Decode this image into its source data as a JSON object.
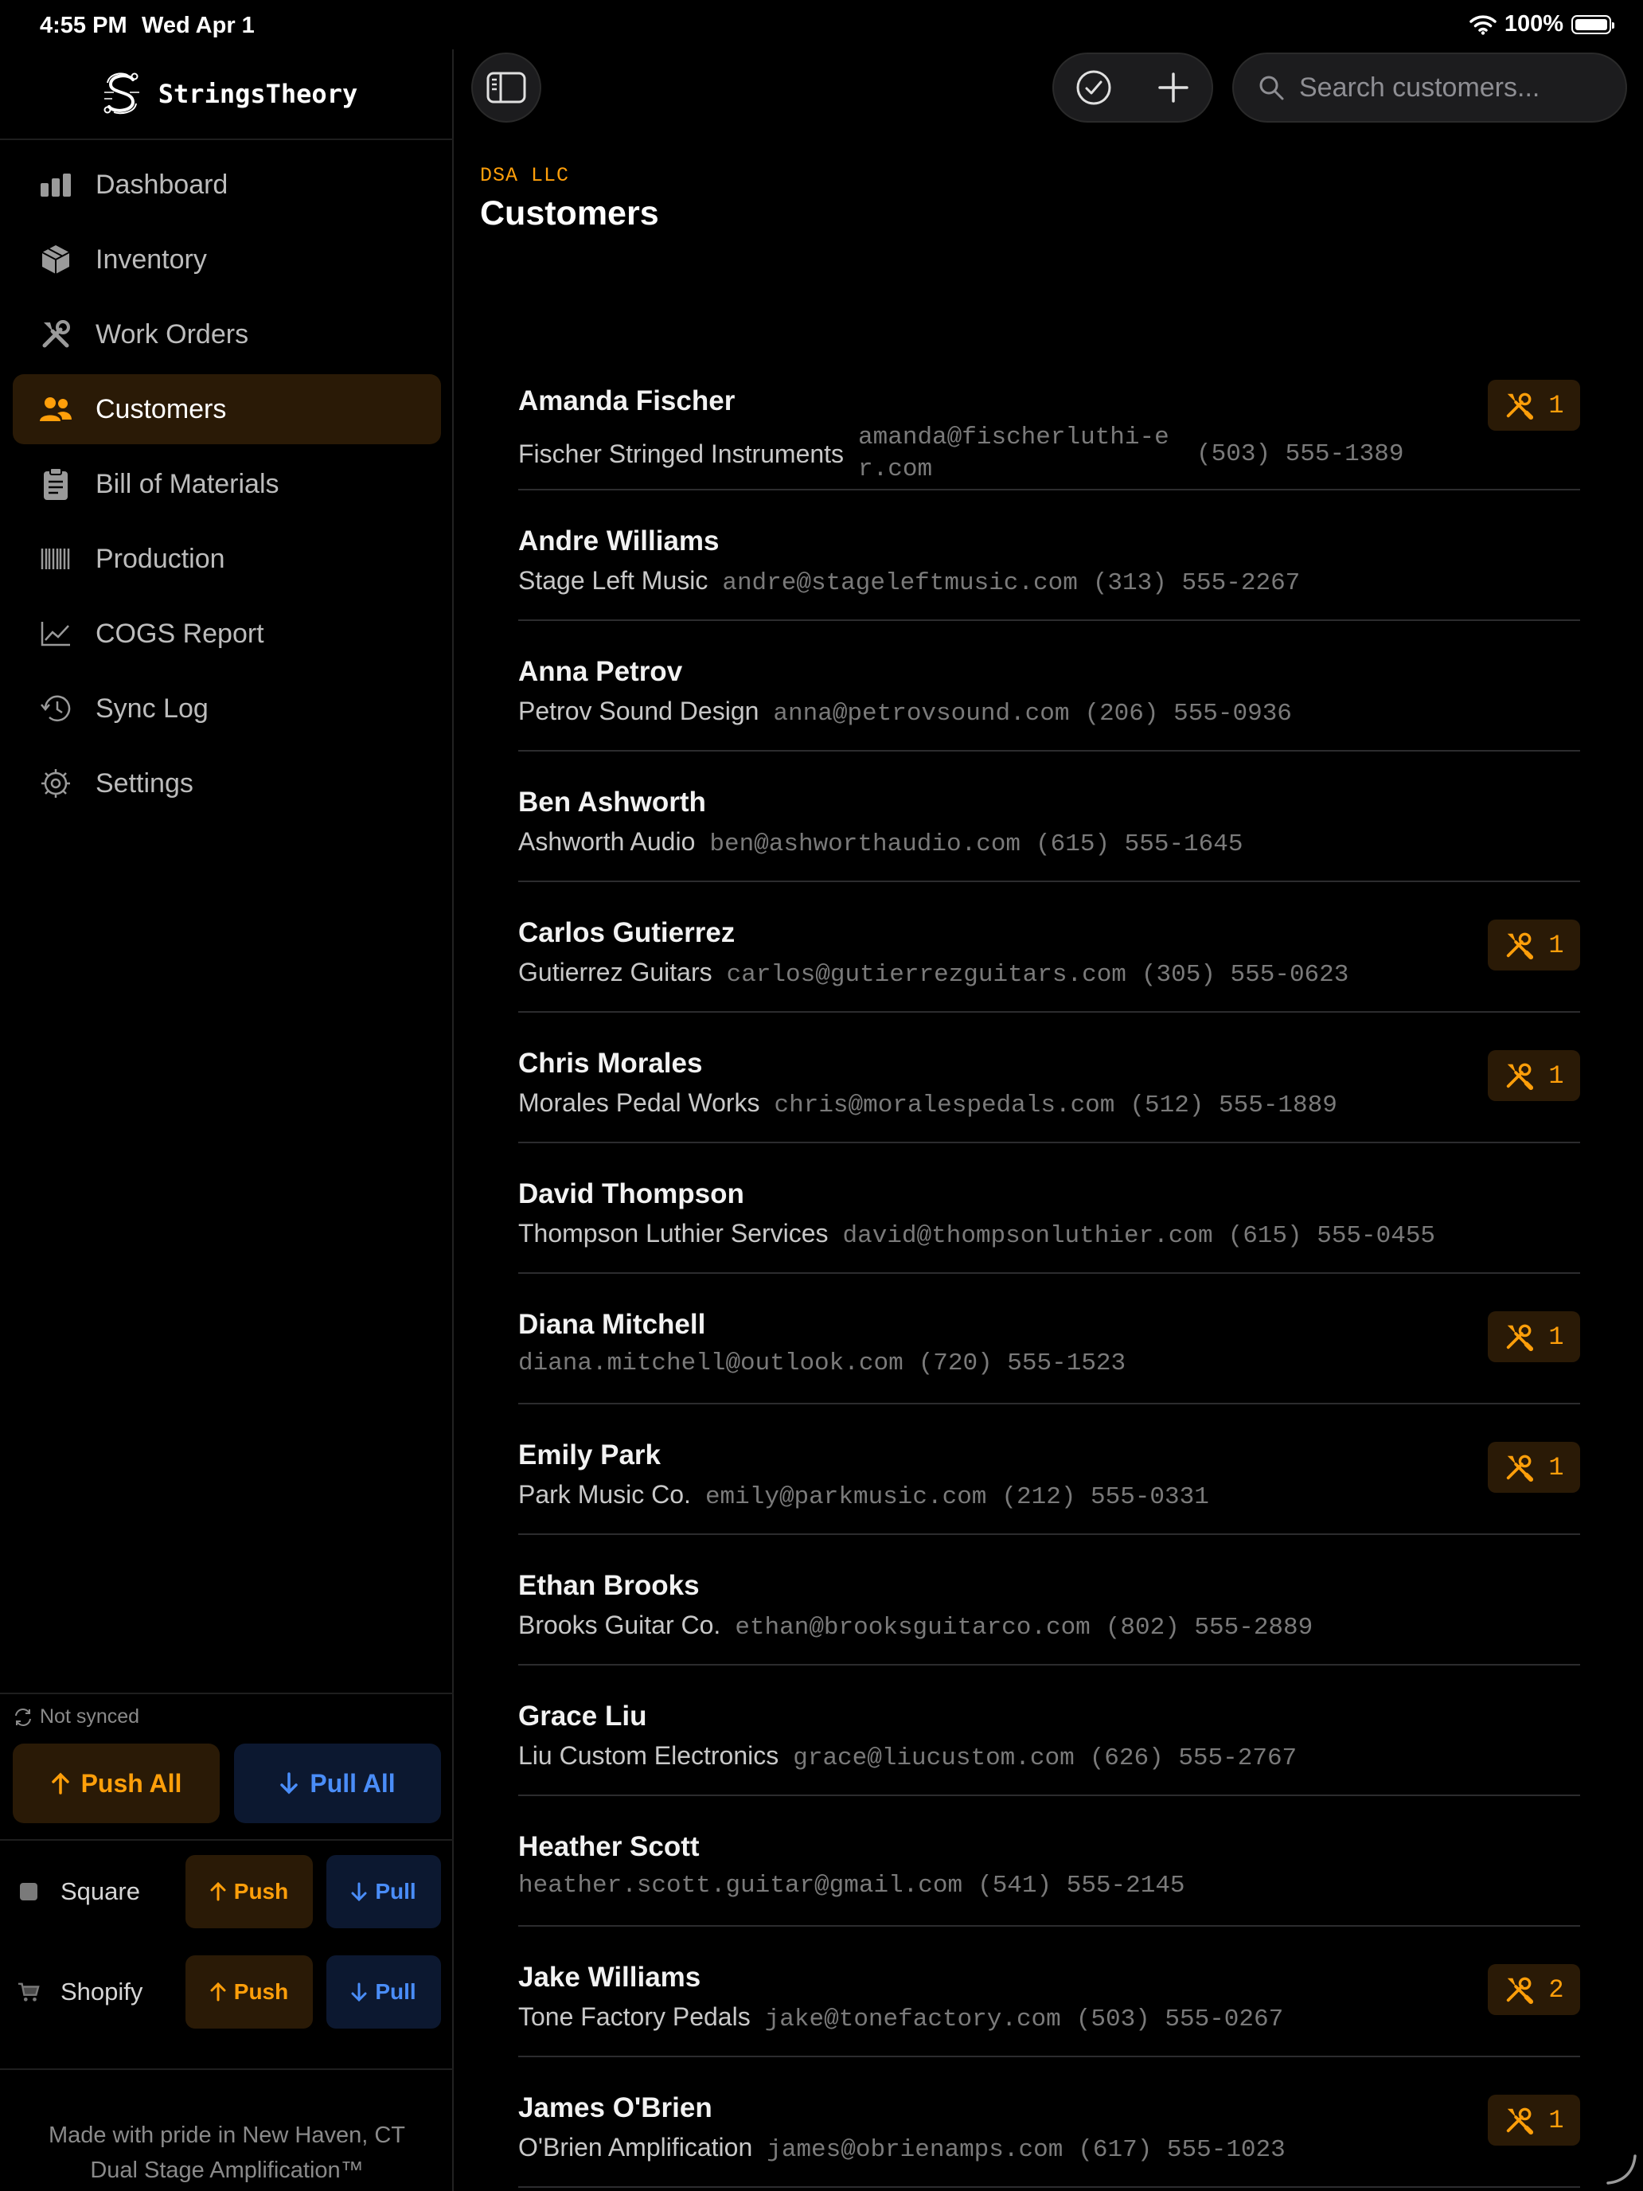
{
  "status_bar": {
    "time": "4:55 PM",
    "date": "Wed Apr 1",
    "battery": "100%"
  },
  "brand": {
    "name": "StringsTheory"
  },
  "nav": [
    {
      "label": "Dashboard",
      "icon": "chart-bar-icon",
      "active": false
    },
    {
      "label": "Inventory",
      "icon": "box-icon",
      "active": false
    },
    {
      "label": "Work Orders",
      "icon": "wrench-screwdriver-icon",
      "active": false
    },
    {
      "label": "Customers",
      "icon": "people-icon",
      "active": true
    },
    {
      "label": "Bill of Materials",
      "icon": "clipboard-icon",
      "active": false
    },
    {
      "label": "Production",
      "icon": "barcode-icon",
      "active": false
    },
    {
      "label": "COGS Report",
      "icon": "line-chart-icon",
      "active": false
    },
    {
      "label": "Sync Log",
      "icon": "history-icon",
      "active": false
    },
    {
      "label": "Settings",
      "icon": "gear-icon",
      "active": false
    }
  ],
  "sync": {
    "status": "Not synced",
    "push_all": "Push All",
    "pull_all": "Pull All",
    "services": [
      {
        "name": "Square",
        "push": "Push",
        "pull": "Pull",
        "icon": "square-icon"
      },
      {
        "name": "Shopify",
        "push": "Push",
        "pull": "Pull",
        "icon": "cart-icon"
      }
    ]
  },
  "footer": {
    "line1": "Made with pride in New Haven, CT",
    "line2": "Dual Stage Amplification™"
  },
  "header": {
    "search_placeholder": "Search customers...",
    "org": "DSA LLC",
    "title": "Customers"
  },
  "customers": [
    {
      "name": "Amanda Fischer",
      "company": "Fischer Stringed Instruments",
      "email": "amanda@fischerluthi-er.com",
      "phone": "(503) 555-1389",
      "work_orders": "1"
    },
    {
      "name": "Andre Williams",
      "company": "Stage Left Music",
      "email": "andre@stageleftmusic.com",
      "phone": "(313) 555-2267",
      "work_orders": ""
    },
    {
      "name": "Anna Petrov",
      "company": "Petrov Sound Design",
      "email": "anna@petrovsound.com",
      "phone": "(206) 555-0936",
      "work_orders": ""
    },
    {
      "name": "Ben Ashworth",
      "company": "Ashworth Audio",
      "email": "ben@ashworthaudio.com",
      "phone": "(615) 555-1645",
      "work_orders": ""
    },
    {
      "name": "Carlos Gutierrez",
      "company": "Gutierrez Guitars",
      "email": "carlos@gutierrezguitars.com",
      "phone": "(305) 555-0623",
      "work_orders": "1"
    },
    {
      "name": "Chris Morales",
      "company": "Morales Pedal Works",
      "email": "chris@moralespedals.com",
      "phone": "(512) 555-1889",
      "work_orders": "1"
    },
    {
      "name": "David Thompson",
      "company": "Thompson Luthier Services",
      "email": "david@thompsonluthier.com",
      "phone": "(615) 555-0455",
      "work_orders": ""
    },
    {
      "name": "Diana Mitchell",
      "company": "",
      "email": "diana.mitchell@outlook.com",
      "phone": "(720) 555-1523",
      "work_orders": "1"
    },
    {
      "name": "Emily Park",
      "company": "Park Music Co.",
      "email": "emily@parkmusic.com",
      "phone": "(212) 555-0331",
      "work_orders": "1"
    },
    {
      "name": "Ethan Brooks",
      "company": "Brooks Guitar Co.",
      "email": "ethan@brooksguitarco.com",
      "phone": "(802) 555-2889",
      "work_orders": ""
    },
    {
      "name": "Grace Liu",
      "company": "Liu Custom Electronics",
      "email": "grace@liucustom.com",
      "phone": "(626) 555-2767",
      "work_orders": ""
    },
    {
      "name": "Heather Scott",
      "company": "",
      "email": "heather.scott.guitar@gmail.com",
      "phone": "(541) 555-2145",
      "work_orders": ""
    },
    {
      "name": "Jake Williams",
      "company": "Tone Factory Pedals",
      "email": "jake@tonefactory.com",
      "phone": "(503) 555-0267",
      "work_orders": "2"
    },
    {
      "name": "James O'Brien",
      "company": "O'Brien Amplification",
      "email": "james@obrienamps.com",
      "phone": "(617) 555-1023",
      "work_orders": "1"
    }
  ],
  "colors": {
    "accent": "#ff9f0a",
    "pull": "#4a8df8",
    "background": "#000000"
  }
}
